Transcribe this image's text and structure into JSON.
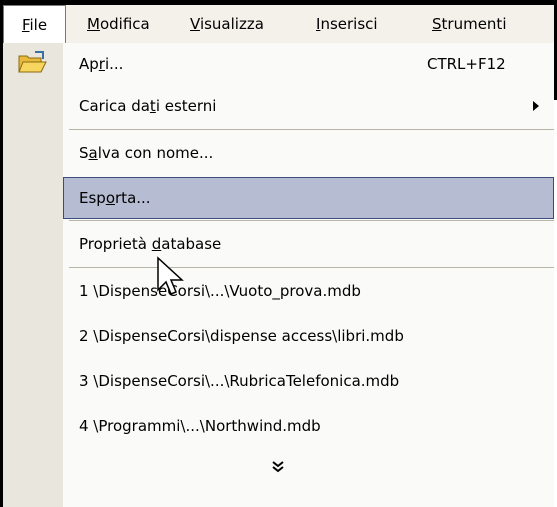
{
  "menubar": {
    "items": [
      {
        "label": "File"
      },
      {
        "label": "Modifica"
      },
      {
        "label": "Visualizza"
      },
      {
        "label": "Inserisci"
      },
      {
        "label": "Strumenti"
      }
    ]
  },
  "menu": {
    "open": {
      "label": "Apri...",
      "shortcut": "CTRL+F12"
    },
    "load_external": {
      "label": "Carica dati esterni"
    },
    "save_as": {
      "label": "Salva con nome..."
    },
    "export": {
      "label": "Esporta..."
    },
    "db_properties": {
      "label": "Proprietà database"
    },
    "recent": [
      {
        "label": "1 \\DispenseCorsi\\...\\Vuoto_prova.mdb"
      },
      {
        "label": "2 \\DispenseCorsi\\dispense access\\libri.mdb"
      },
      {
        "label": "3 \\DispenseCorsi\\...\\RubricaTelefonica.mdb"
      },
      {
        "label": "4 \\Programmi\\...\\Northwind.mdb"
      }
    ]
  },
  "icons": {
    "open": "folder-open-icon",
    "expand": "double-chevron-down-icon",
    "cursor": "mouse-pointer-icon"
  },
  "colors": {
    "highlight": "#b6bdd2",
    "highlight_border": "#3b4d80",
    "gutter": "#e9e6dd"
  }
}
